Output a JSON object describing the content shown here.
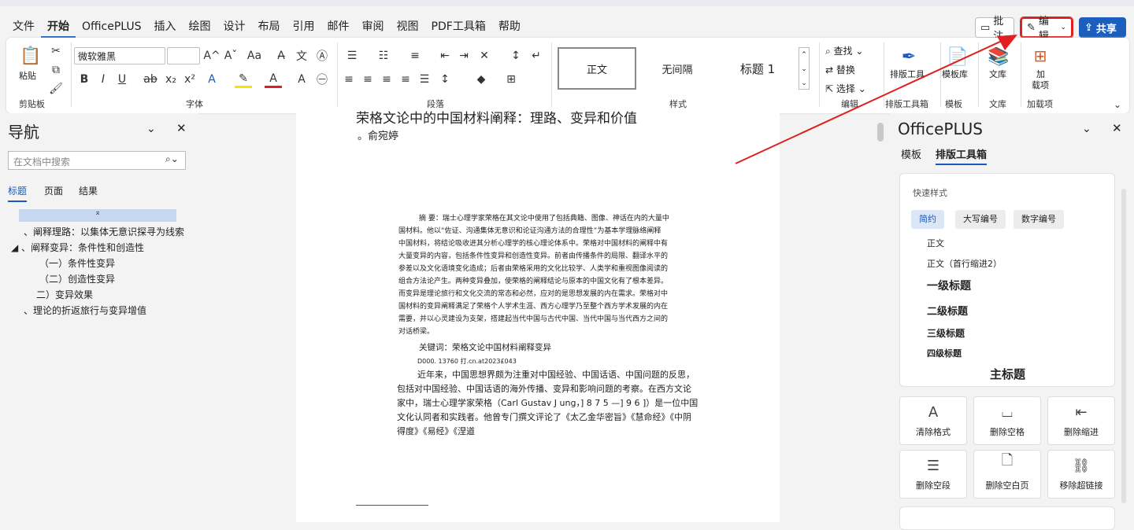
{
  "tabs": [
    "文件",
    "开始",
    "OfficePLUS",
    "插入",
    "绘图",
    "设计",
    "布局",
    "引用",
    "邮件",
    "审阅",
    "视图",
    "PDF工具箱",
    "帮助"
  ],
  "active_tab": "开始",
  "top_right": {
    "comment": "批注",
    "edit": "编辑",
    "share": "共享"
  },
  "ribbon": {
    "clipboard": {
      "paste": "粘贴",
      "label": "剪贴板"
    },
    "font": {
      "name": "微软雅黑",
      "size": "",
      "label": "字体"
    },
    "paragraph": {
      "label": "段落"
    },
    "styles": {
      "items": [
        "正文",
        "无间隔",
        "标题 1"
      ],
      "label": "样式"
    },
    "editing": {
      "find": "查找",
      "replace": "替换",
      "select": "选择",
      "label": "编辑"
    },
    "typeset": {
      "btn": "排版工具",
      "label": "排版工具箱"
    },
    "template": {
      "btn": "模板库",
      "label": "模板"
    },
    "library": {
      "btn": "文库",
      "label": "文库"
    },
    "addins": {
      "btn1": "加",
      "btn2": "载项",
      "label": "加载项"
    }
  },
  "nav": {
    "title": "导航",
    "search_placeholder": "在文档中搜索",
    "tabs": [
      "标题",
      "页面",
      "结果"
    ],
    "headings": [
      "、阐释理路：以集体无意识探寻为线索",
      "、阐释变异：条件性和创造性",
      "（一）条件性变异",
      "（二）创造性变异",
      "二）变异效果",
      "、理论的折返旅行与变异增值"
    ]
  },
  "doc": {
    "title": "荣格文论中的中国材料阐释：理路、变异和价值",
    "author": "。俞宛婷",
    "abstract_lines": [
      "摘 要：瑞士心理学家荣格在其文论中使用了包括典籍、图像、神话在内的大量中",
      "国材料。他以“佐证、沟通集体无意识和论证沟通方法的合理性”为基本学理脉络阐释",
      "中国材料，将结论吸收进其分析心理学的核心理论体系中。荣格对中国材料的阐释中有",
      "大量变异的内容，包括条件性变异和创造性变异。前者由传播条件的局限、翻译水平的",
      "参差以及文化语境变化造成；后者由荣格采用的文化比较学、人类学和重视图像阅读的",
      "组合方法论产生。两种变异叠加，使荣格的阐释结论与原本的中国文化有了根本差异。",
      "而变异是理论旅行和文化交流的常态和必然，应对的是思想发展的内在需求。荣格对中",
      "国材料的变异阐释满足了荣格个人学术生涯、西方心理学乃至整个西方学术发展的内在",
      "需要，并以心灵建设为支架，搭建起当代中国与古代中国、当代中国与当代西方之间的",
      "对话桥梁。"
    ],
    "keywords": "关键词：荣格文论中国材料阐释变异",
    "doi": "D000.  13760 打.cn.at2023£043",
    "body_lines": [
      "近年来，中国思想界颇为注重对中国经验、中国话语、中国问题的反思，",
      "包括对中国经验、中国话语的海外传播、变异和影响问题的考察。在西方文论",
      "家中，瑞士心理学家荣格（Carl Gustav J ung，] 8 7 5 —] 9 6 ]）是一位中国",
      "文化认同者和实践者。他曾专门撰文评论了《太乙金华密旨》《慧命经》《中阴",
      "得度》《易经》《涅道"
    ]
  },
  "right_pane": {
    "title": "OfficePLUS",
    "tabs": [
      "模板",
      "排版工具箱"
    ],
    "quick_style": "快速样式",
    "pills": [
      "简约",
      "大写编号",
      "数字编号"
    ],
    "styles": [
      "正文",
      "正文（首行缩进2）",
      "一级标题",
      "二级标题",
      "三级标题",
      "四级标题",
      "主标题"
    ],
    "tools": [
      "清除格式",
      "删除空格",
      "删除缩进",
      "删除空段",
      "删除空白页",
      "移除超链接"
    ]
  },
  "colors": {
    "accent": "#185abd",
    "highlight": "#e02020"
  }
}
